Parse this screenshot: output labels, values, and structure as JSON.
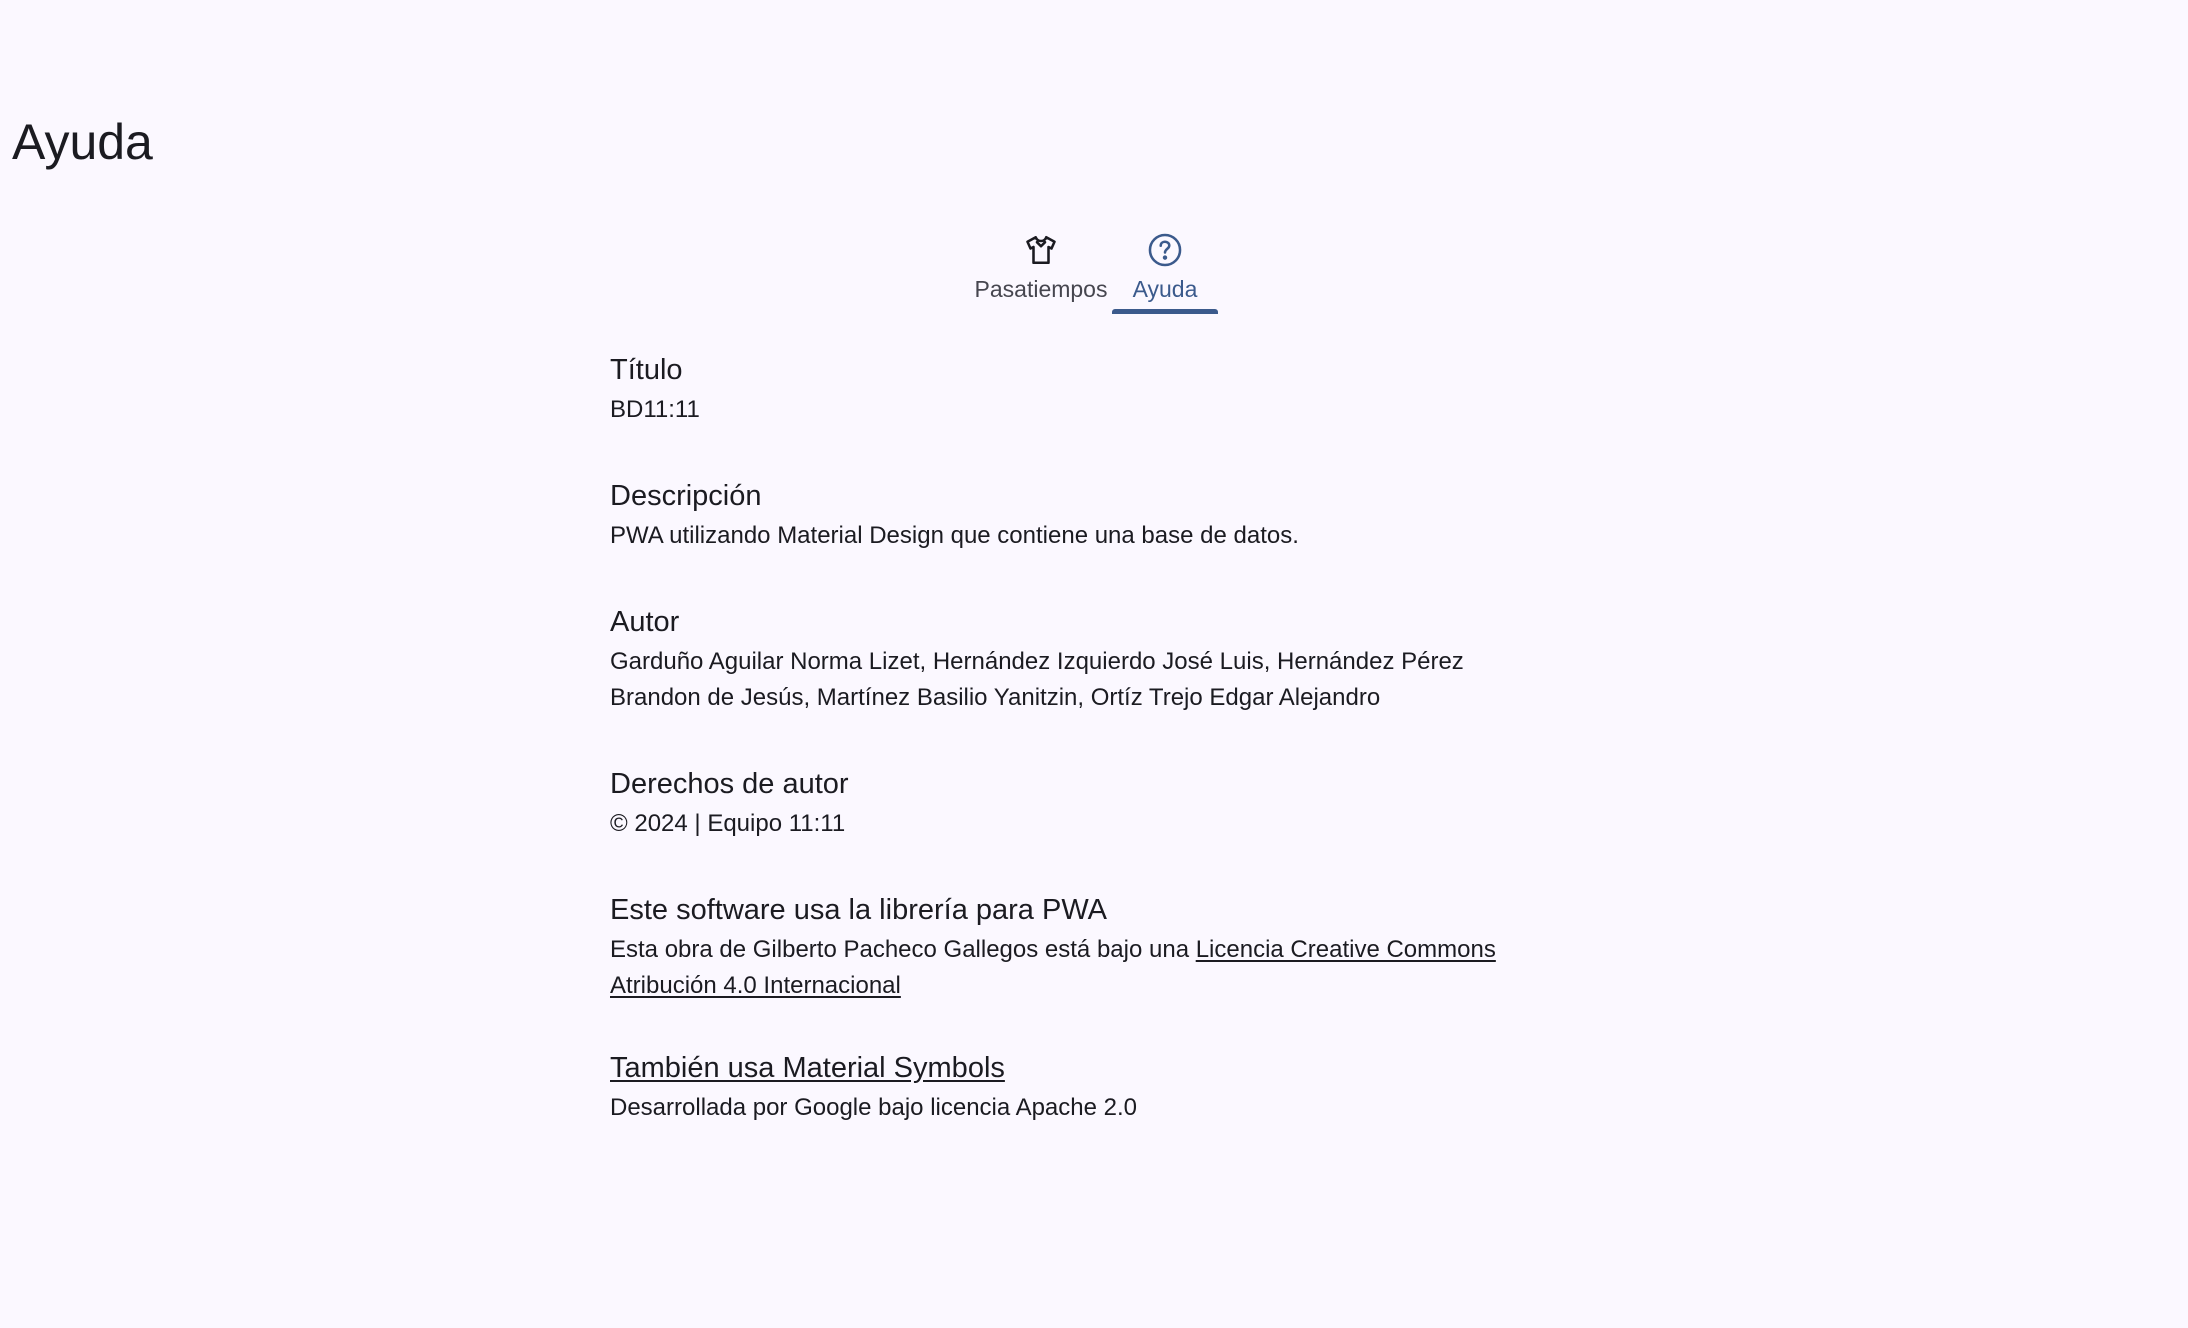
{
  "header": {
    "title": "Ayuda"
  },
  "tabs": [
    {
      "label": "Pasatiempos",
      "icon": "tshirt-icon",
      "active": false
    },
    {
      "label": "Ayuda",
      "icon": "help-circle-icon",
      "active": true
    }
  ],
  "colors": {
    "background": "#fbf8ff",
    "accent": "#3b5a8c",
    "text": "#1b1b21"
  },
  "sections": {
    "titulo": {
      "heading": "Título",
      "body": "BD11:11"
    },
    "descripcion": {
      "heading": "Descripción",
      "body": "PWA utilizando Material Design que contiene una base de datos."
    },
    "autor": {
      "heading": "Autor",
      "body": "Garduño Aguilar Norma Lizet, Hernández Izquierdo José Luis, Hernández Pérez Brandon de Jesús, Martínez Basilio Yanitzin, Ortíz Trejo Edgar Alejandro"
    },
    "derechos": {
      "heading": "Derechos de autor",
      "body": "© 2024 | Equipo 11:11"
    },
    "pwa": {
      "heading": "Este software usa la librería para PWA",
      "body_prefix": "Esta obra de Gilberto Pacheco Gallegos está bajo una ",
      "link_text": "Licencia Creative Commons Atribución 4.0 Internacional"
    },
    "symbols": {
      "heading_link": "También usa Material Symbols",
      "body": "Desarrollada por Google bajo licencia Apache 2.0"
    }
  }
}
